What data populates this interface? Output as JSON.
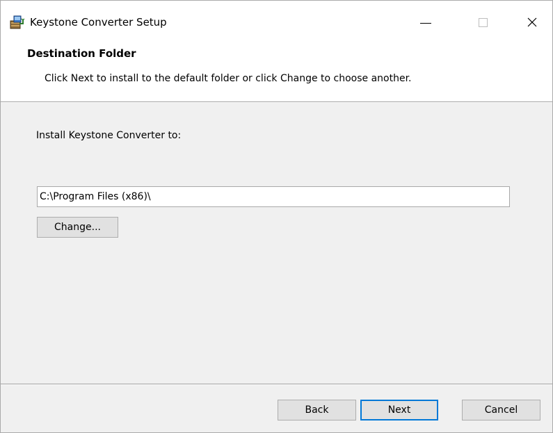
{
  "window": {
    "title": "Keystone Converter Setup",
    "accent_color": "#0078d7",
    "icon": "installer-package-icon"
  },
  "titlebar": {
    "minimize_icon": "minimize-icon",
    "maximize_icon": "maximize-icon",
    "close_icon": "close-icon"
  },
  "header": {
    "title": "Destination Folder",
    "description": "Click Next to install to the default folder or click Change to choose another."
  },
  "body": {
    "install_label": "Install Keystone Converter to:",
    "path_value": "C:\\Program Files (x86)\\",
    "change_label": "Change..."
  },
  "footer": {
    "back_label": "Back",
    "next_label": "Next",
    "cancel_label": "Cancel"
  }
}
